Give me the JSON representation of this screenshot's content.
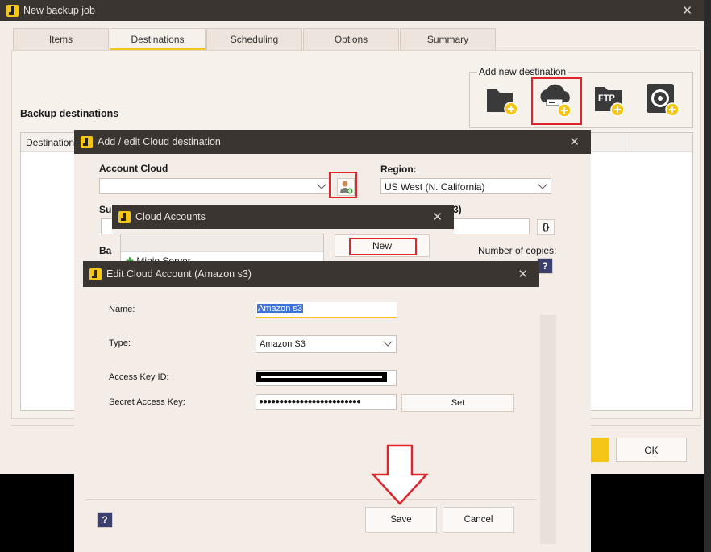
{
  "main": {
    "title": "New backup job",
    "tabs": [
      "Items",
      "Destinations",
      "Scheduling",
      "Options",
      "Summary"
    ],
    "add_new_destination": "Add new destination",
    "backup_destinations": "Backup destinations",
    "column_destination": "Destination",
    "ok": "OK",
    "ftp_text": "FTP"
  },
  "cloud_dialog": {
    "title": "Add / edit Cloud destination",
    "account_cloud": "Account Cloud",
    "region_label": "Region:",
    "region_value": "US West (N. California)",
    "sub_label": "Sub",
    "bac_label": "Bac",
    "s3_fragment": "3)",
    "braces": "{}",
    "number_of_copies": "Number of copies:",
    "help": "?"
  },
  "accounts_dialog": {
    "title": "Cloud Accounts",
    "new_button": "New",
    "list_item": "Minio Server"
  },
  "edit_dialog": {
    "title": "Edit Cloud Account (Amazon s3)",
    "name_label": "Name:",
    "name_value": "Amazon s3",
    "type_label": "Type:",
    "type_value": "Amazon S3",
    "access_key_label": "Access Key ID:",
    "secret_key_label": "Secret Access Key:",
    "secret_mask": "●●●●●●●●●●●●●●●●●●●●●●●●●",
    "set_button": "Set",
    "save_button": "Save",
    "cancel_button": "Cancel",
    "help": "?"
  },
  "colors": {
    "accent": "#f5c518",
    "titlebar": "#3b3532",
    "highlight": "#e0242b",
    "window_bg": "#f4ece6"
  }
}
